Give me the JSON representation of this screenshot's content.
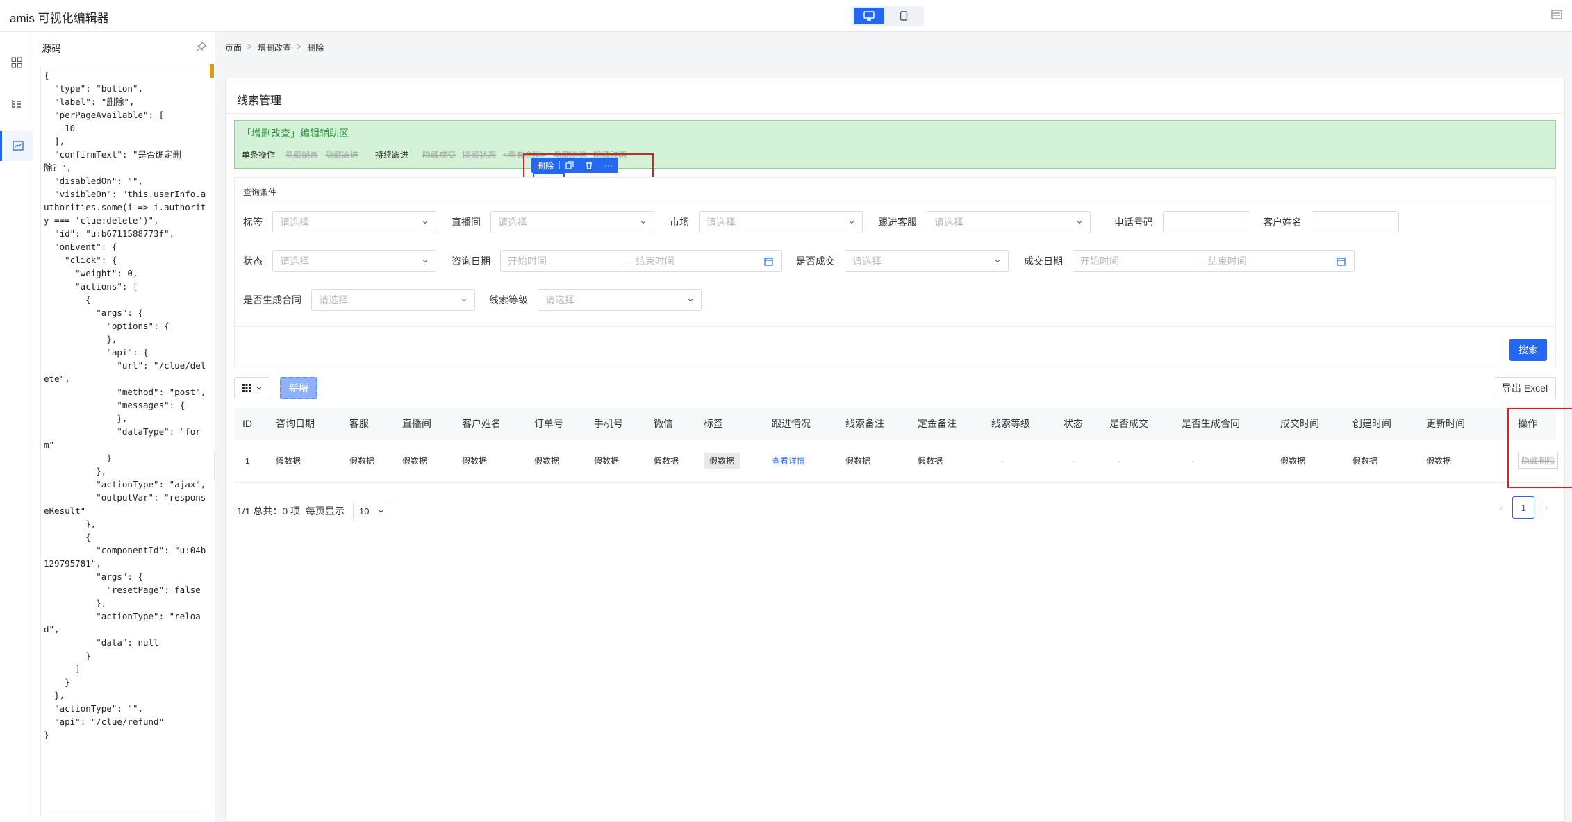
{
  "app": {
    "title": "amis 可视化编辑器"
  },
  "source": {
    "header": "源码",
    "code": "{\n  \"type\": \"button\",\n  \"label\": \"删除\",\n  \"perPageAvailable\": [\n    10\n  ],\n  \"confirmText\": \"是否确定删除？\",\n  \"disabledOn\": \"\",\n  \"visibleOn\": \"this.userInfo.authorities.some(i => i.authority === 'clue:delete')\",\n  \"id\": \"u:b6711588773f\",\n  \"onEvent\": {\n    \"click\": {\n      \"weight\": 0,\n      \"actions\": [\n        {\n          \"args\": {\n            \"options\": {\n            },\n            \"api\": {\n              \"url\": \"/clue/delete\",\n              \"method\": \"post\",\n              \"messages\": {\n              },\n              \"dataType\": \"form\"\n            }\n          },\n          \"actionType\": \"ajax\",\n          \"outputVar\": \"responseResult\"\n        },\n        {\n          \"componentId\": \"u:04b129795781\",\n          \"args\": {\n            \"resetPage\": false\n          },\n          \"actionType\": \"reload\",\n          \"data\": null\n        }\n      ]\n    }\n  },\n  \"actionType\": \"\",\n  \"api\": \"/clue/refund\"\n}"
  },
  "breadcrumb": {
    "items": [
      "页面",
      "增删改查",
      "删除"
    ],
    "sep": ">"
  },
  "page": {
    "title": "线索管理"
  },
  "helper": {
    "title": "「增删改查」编辑辅助区",
    "single_label": "单条操作",
    "ghost_1": "隐藏配置",
    "ghost_2": "隐藏跟进",
    "follow_label": "持续跟进",
    "ghost_3": "隐藏成交",
    "ghost_4": "隐藏状态",
    "ghost_5": "<查看合同>",
    "ghost_6": "隐藏删除",
    "ghost_7": "隐藏改态"
  },
  "toolbar_pop": {
    "label": "删除",
    "more": "···"
  },
  "query": {
    "title": "查询条件",
    "placeholder": "请选择",
    "start_placeholder": "开始时间",
    "end_placeholder": "结束时间",
    "dash": "–",
    "labels": {
      "tag": "标签",
      "live": "直播间",
      "market": "市场",
      "follow_cs": "跟进客服",
      "phone": "电话号码",
      "customer": "客户姓名",
      "status": "状态",
      "consult_date": "咨询日期",
      "is_deal": "是否成交",
      "deal_date": "成交日期",
      "contract": "是否生成合同",
      "level": "线索等级"
    },
    "search_label": "搜索"
  },
  "crud": {
    "add_label": "新增",
    "export_label": "导出 Excel"
  },
  "table": {
    "columns": [
      "ID",
      "咨询日期",
      "客服",
      "直播间",
      "客户姓名",
      "订单号",
      "手机号",
      "微信",
      "标签",
      "跟进情况",
      "线索备注",
      "定金备注",
      "线索等级",
      "状态",
      "是否成交",
      "是否生成合同",
      "成交时间",
      "创建时间",
      "更新时间",
      "操作"
    ],
    "row": [
      "1",
      "假数据",
      "假数据",
      "假数据",
      "假数据",
      "假数据",
      "假数据",
      "假数据",
      "假数据",
      "查看详情",
      "假数据",
      "假数据",
      "-",
      "-",
      "-",
      "-",
      "假数据",
      "假数据",
      "假数据",
      "隐藏删除"
    ]
  },
  "pager": {
    "summary": "1/1 总共：0 项",
    "perpage_label": "每页显示",
    "perpage_value": "10",
    "prev": "‹",
    "page": "1",
    "next": "›"
  },
  "colors": {
    "accent": "#2468f2",
    "helper_bg": "#d3f2d8",
    "highlight": "#e02020"
  }
}
